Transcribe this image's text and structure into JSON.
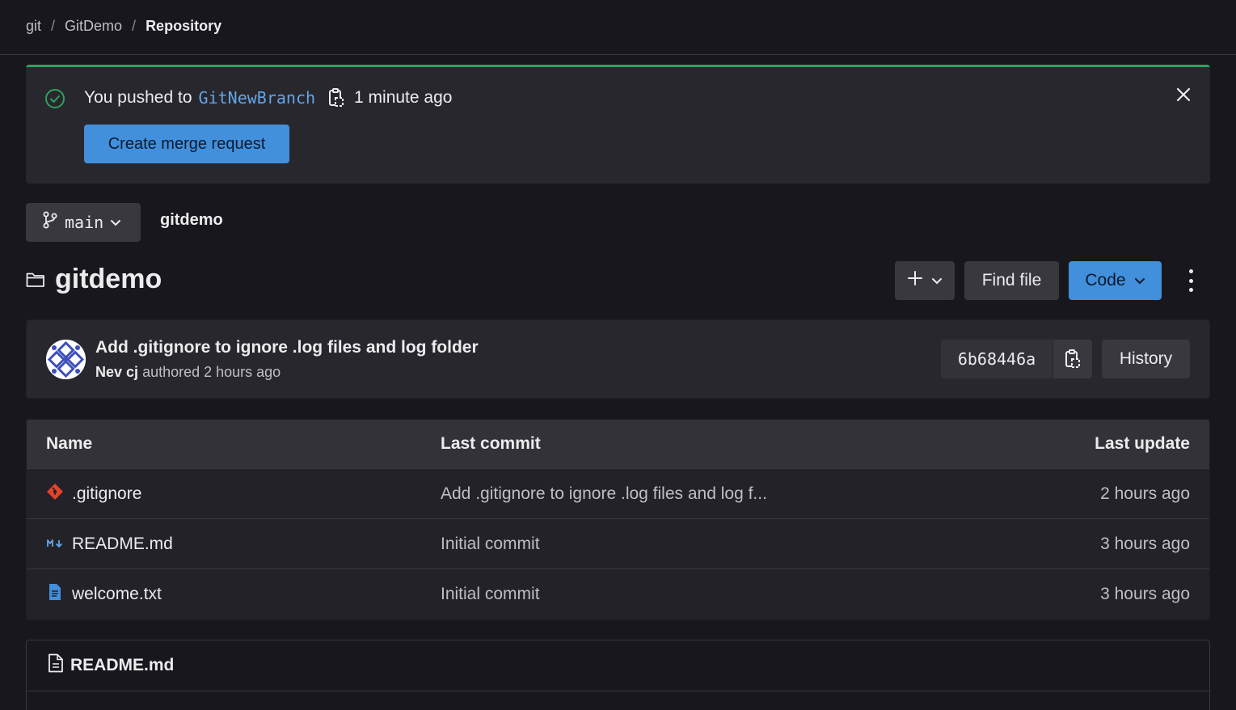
{
  "breadcrumb": {
    "items": [
      "git",
      "GitDemo"
    ],
    "separator": "/",
    "current": "Repository"
  },
  "alert": {
    "prefix": "You pushed to",
    "branch": "GitNewBranch",
    "time": "1 minute ago",
    "button": "Create merge request"
  },
  "branch_selector": {
    "label": "main"
  },
  "repo_crumb": "gitdemo",
  "title": "gitdemo",
  "actions": {
    "find_file": "Find file",
    "code": "Code"
  },
  "last_commit": {
    "title": "Add .gitignore to ignore .log files and log folder",
    "author": "Nev cj",
    "meta": "authored 2 hours ago",
    "sha": "6b68446a",
    "history": "History"
  },
  "table": {
    "headers": {
      "name": "Name",
      "commit": "Last commit",
      "update": "Last update"
    },
    "rows": [
      {
        "name": ".gitignore",
        "icon": "git-logo-icon",
        "commit": "Add .gitignore to ignore .log files and log f...",
        "update": "2 hours ago"
      },
      {
        "name": "README.md",
        "icon": "markdown-icon",
        "commit": "Initial commit",
        "update": "3 hours ago"
      },
      {
        "name": "welcome.txt",
        "icon": "text-file-icon",
        "commit": "Initial commit",
        "update": "3 hours ago"
      }
    ]
  },
  "readme": {
    "title": "README.md"
  },
  "colors": {
    "background": "#18171d",
    "panel": "#28272d",
    "accent": "#428fdc",
    "link": "#63a6e9",
    "success": "#2da160",
    "git_orange": "#e24329"
  }
}
